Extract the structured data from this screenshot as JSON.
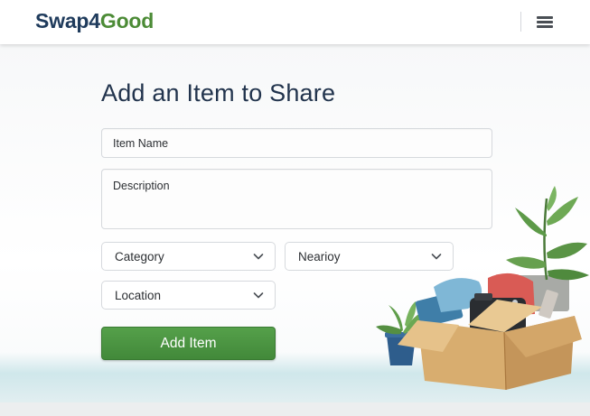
{
  "header": {
    "logo_part1": "Swap4",
    "logo_part2": "Good",
    "menu_icon": "hamburger-menu-icon"
  },
  "form": {
    "title": "Add an Item to Share",
    "item_name_placeholder": "Item Name",
    "description_placeholder": "Description",
    "category_label": "Category",
    "nearby_label": "Nearioy",
    "location_label": "Location",
    "submit_label": "Add Item"
  },
  "colors": {
    "brand_navy": "#1f3b5c",
    "brand_green": "#4c8b36",
    "button_green": "#4a9640",
    "title_color": "#22344d"
  }
}
